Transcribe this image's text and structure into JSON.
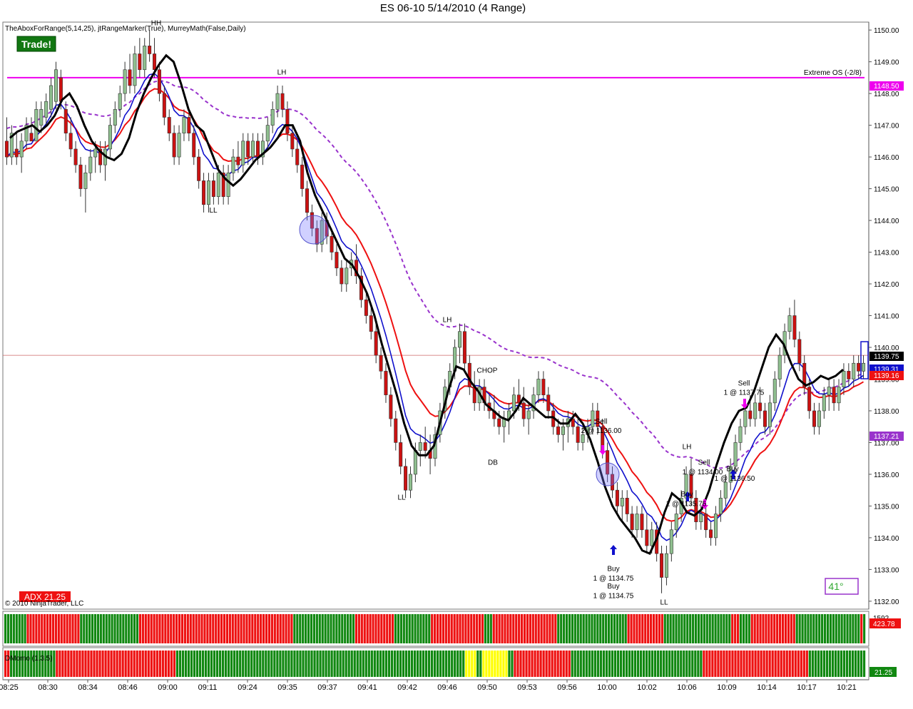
{
  "window": {
    "title": "ES 06-10  5/14/2010 (4 Range)",
    "indicator_text": "TheAboxForRange(5,14,25), jtRangeMarker(True), MurreyMath(False,Daily)",
    "trade_button": "Trade!",
    "copyright": "© 2010 NinjaTrader, LLC",
    "adx_label": "ADX 21.25",
    "angle_badge": "41°",
    "panel3_label": "DMomo (1.3.5)",
    "panel2_value": "423.78",
    "panel2_value_top": "1592",
    "panel3_value": "21.25"
  },
  "colors": {
    "up": "#8fbf8f",
    "down": "#cc1111",
    "ema_red": "#ee1111",
    "ema_blue": "#1010cc",
    "ema_orange": "#e08a00",
    "dashed": "#9933cc",
    "magenta": "#ee00ee",
    "green_bar": "#118811",
    "red_bar": "#ee1111",
    "yellow_bar": "#ffff00"
  },
  "chart_data": {
    "type": "candlestick",
    "title": "ES 06-10  5/14/2010 (4 Range)",
    "y_axis": {
      "range": [
        1131.75,
        1150.25
      ],
      "ticks": [
        "1150.00",
        "1149.00",
        "1148.00",
        "1147.00",
        "1146.00",
        "1145.00",
        "1144.00",
        "1143.00",
        "1142.00",
        "1141.00",
        "1140.00",
        "1139.00",
        "1138.00",
        "1137.00",
        "1136.00",
        "1135.00",
        "1134.00",
        "1133.00",
        "1132.00"
      ]
    },
    "x_axis": {
      "labels": [
        "08:25",
        "08:30",
        "08:34",
        "08:46",
        "09:00",
        "09:11",
        "09:24",
        "09:35",
        "09:37",
        "09:41",
        "09:42",
        "09:46",
        "09:50",
        "09:53",
        "09:56",
        "10:00",
        "10:02",
        "10:06",
        "10:09",
        "10:14",
        "10:17",
        "10:21"
      ]
    },
    "price_tags": [
      {
        "label": "1148.50",
        "price": 1148.5,
        "color": "#ee00ee"
      },
      {
        "label": "1139.75",
        "price": 1139.75,
        "color": "#000000"
      },
      {
        "label": "1139.31",
        "price": 1139.31,
        "color": "#1010cc"
      },
      {
        "label": "1139.16",
        "price": 1139.16,
        "color": "#ee1111"
      },
      {
        "label": "1137.21",
        "price": 1137.21,
        "color": "#9933cc"
      }
    ],
    "murrey_line": {
      "label": "Extreme OS (-2/8)",
      "price": 1148.5
    },
    "last_price_line": 1139.75,
    "annotations": [
      {
        "text": "HH",
        "price": 1150.15
      },
      {
        "text": "LH",
        "price": 1148.6
      },
      {
        "text": "LL",
        "price": 1144.25
      },
      {
        "text": "LL",
        "price": 1135.2
      },
      {
        "text": "LH",
        "price": 1140.8
      },
      {
        "text": "CHOP",
        "price": 1139.2
      },
      {
        "text": "DB",
        "price": 1136.3
      },
      {
        "text": "Sell",
        "price": 1137.6
      },
      {
        "text": "2 @ 1136.00",
        "price": 1137.3
      },
      {
        "text": "Buy",
        "price": 1132.95
      },
      {
        "text": "1 @ 1134.75",
        "price": 1132.65
      },
      {
        "text": "Buy",
        "price": 1132.4
      },
      {
        "text": "1 @ 1134.75",
        "price": 1132.1
      },
      {
        "text": "LL",
        "price": 1131.9
      },
      {
        "text": "LH",
        "price": 1136.8
      },
      {
        "text": "Sell",
        "price": 1136.3
      },
      {
        "text": "1 @ 1134.00",
        "price": 1136.0
      },
      {
        "text": "Buy",
        "price": 1135.3
      },
      {
        "text": "1 @ 1135.75",
        "price": 1135.0
      },
      {
        "text": "Buy",
        "price": 1136.1
      },
      {
        "text": "1 @ 1136.50",
        "price": 1135.8
      },
      {
        "text": "Sell",
        "price": 1138.8
      },
      {
        "text": "1 @ 1137.75",
        "price": 1138.5
      }
    ],
    "candles": [
      [
        1146.5,
        1147.25,
        1145.75,
        1146.0
      ],
      [
        1146.0,
        1147.0,
        1145.75,
        1146.75
      ],
      [
        1146.25,
        1146.75,
        1145.75,
        1146.0
      ],
      [
        1146.0,
        1146.75,
        1145.5,
        1146.5
      ],
      [
        1146.5,
        1147.25,
        1146.25,
        1147.0
      ],
      [
        1146.75,
        1147.25,
        1146.5,
        1146.5
      ],
      [
        1146.5,
        1147.75,
        1146.5,
        1147.5
      ],
      [
        1147.0,
        1147.75,
        1146.75,
        1147.5
      ],
      [
        1147.25,
        1148.0,
        1147.0,
        1147.75
      ],
      [
        1147.5,
        1148.5,
        1147.25,
        1148.25
      ],
      [
        1147.75,
        1149.0,
        1147.5,
        1148.75
      ],
      [
        1148.5,
        1148.75,
        1147.5,
        1147.75
      ],
      [
        1147.5,
        1147.75,
        1146.5,
        1146.75
      ],
      [
        1146.75,
        1147.25,
        1146.0,
        1146.25
      ],
      [
        1146.25,
        1146.5,
        1145.5,
        1145.75
      ],
      [
        1145.75,
        1146.0,
        1144.75,
        1145.0
      ],
      [
        1145.0,
        1145.75,
        1144.25,
        1145.5
      ],
      [
        1145.5,
        1146.25,
        1145.25,
        1146.0
      ],
      [
        1146.0,
        1146.5,
        1145.5,
        1146.25
      ],
      [
        1146.25,
        1146.5,
        1145.5,
        1145.75
      ],
      [
        1145.75,
        1146.5,
        1145.25,
        1146.25
      ],
      [
        1146.25,
        1147.25,
        1146.0,
        1147.0
      ],
      [
        1147.0,
        1147.75,
        1146.75,
        1147.5
      ],
      [
        1147.5,
        1148.25,
        1147.25,
        1148.0
      ],
      [
        1148.0,
        1149.0,
        1147.75,
        1148.75
      ],
      [
        1148.75,
        1149.25,
        1148.0,
        1148.25
      ],
      [
        1148.25,
        1149.5,
        1148.0,
        1149.25
      ],
      [
        1149.25,
        1149.75,
        1148.5,
        1148.75
      ],
      [
        1148.75,
        1149.75,
        1148.5,
        1149.5
      ],
      [
        1149.5,
        1150.0,
        1149.0,
        1149.25
      ],
      [
        1149.25,
        1149.75,
        1148.5,
        1148.75
      ],
      [
        1148.75,
        1149.0,
        1147.75,
        1148.0
      ],
      [
        1148.0,
        1148.25,
        1147.0,
        1147.25
      ],
      [
        1147.25,
        1147.5,
        1146.5,
        1146.75
      ],
      [
        1146.75,
        1147.0,
        1145.75,
        1146.0
      ],
      [
        1146.0,
        1147.0,
        1145.75,
        1146.75
      ],
      [
        1146.75,
        1147.5,
        1146.5,
        1147.25
      ],
      [
        1147.25,
        1147.5,
        1146.5,
        1146.75
      ],
      [
        1146.75,
        1147.0,
        1145.75,
        1146.0
      ],
      [
        1146.0,
        1146.25,
        1145.0,
        1145.25
      ],
      [
        1145.25,
        1145.5,
        1144.25,
        1144.5
      ],
      [
        1144.5,
        1145.5,
        1144.25,
        1145.25
      ],
      [
        1145.25,
        1145.5,
        1144.5,
        1144.75
      ],
      [
        1144.75,
        1145.75,
        1144.5,
        1145.5
      ],
      [
        1145.5,
        1145.75,
        1144.5,
        1144.75
      ],
      [
        1144.75,
        1145.75,
        1144.5,
        1145.5
      ],
      [
        1145.5,
        1146.25,
        1145.25,
        1146.0
      ],
      [
        1146.0,
        1146.5,
        1145.5,
        1145.75
      ],
      [
        1145.75,
        1146.75,
        1145.5,
        1146.5
      ],
      [
        1146.5,
        1146.75,
        1145.75,
        1146.0
      ],
      [
        1146.0,
        1146.75,
        1145.75,
        1146.5
      ],
      [
        1146.5,
        1146.75,
        1145.75,
        1146.0
      ],
      [
        1146.0,
        1146.75,
        1145.75,
        1146.5
      ],
      [
        1146.5,
        1147.25,
        1146.25,
        1147.0
      ],
      [
        1147.0,
        1147.75,
        1146.75,
        1147.5
      ],
      [
        1147.5,
        1148.25,
        1147.25,
        1148.0
      ],
      [
        1148.0,
        1148.25,
        1147.25,
        1147.5
      ],
      [
        1147.5,
        1147.75,
        1146.5,
        1146.75
      ],
      [
        1146.75,
        1147.0,
        1146.0,
        1146.25
      ],
      [
        1146.25,
        1146.5,
        1145.5,
        1145.75
      ],
      [
        1145.75,
        1146.0,
        1144.75,
        1145.0
      ],
      [
        1145.0,
        1145.25,
        1144.0,
        1144.25
      ],
      [
        1144.25,
        1144.5,
        1143.5,
        1143.75
      ],
      [
        1143.75,
        1144.0,
        1143.0,
        1143.25
      ],
      [
        1143.25,
        1144.25,
        1143.0,
        1144.0
      ],
      [
        1144.0,
        1144.25,
        1143.25,
        1143.5
      ],
      [
        1143.5,
        1143.75,
        1142.75,
        1143.0
      ],
      [
        1143.0,
        1143.25,
        1142.25,
        1142.5
      ],
      [
        1142.5,
        1142.75,
        1141.75,
        1142.0
      ],
      [
        1142.0,
        1142.75,
        1141.75,
        1142.5
      ],
      [
        1142.5,
        1143.0,
        1142.25,
        1142.75
      ],
      [
        1142.75,
        1143.25,
        1142.0,
        1142.25
      ],
      [
        1142.25,
        1142.5,
        1141.25,
        1141.5
      ],
      [
        1141.5,
        1141.75,
        1140.75,
        1141.0
      ],
      [
        1141.0,
        1141.25,
        1140.25,
        1140.5
      ],
      [
        1140.5,
        1140.75,
        1139.5,
        1139.75
      ],
      [
        1139.75,
        1140.0,
        1139.0,
        1139.25
      ],
      [
        1139.25,
        1139.5,
        1138.25,
        1138.5
      ],
      [
        1138.5,
        1138.75,
        1137.5,
        1137.75
      ],
      [
        1137.75,
        1138.0,
        1136.75,
        1137.0
      ],
      [
        1137.0,
        1137.25,
        1136.0,
        1136.25
      ],
      [
        1136.25,
        1136.5,
        1135.25,
        1135.5
      ],
      [
        1135.5,
        1136.25,
        1135.25,
        1136.0
      ],
      [
        1136.0,
        1137.0,
        1135.75,
        1136.75
      ],
      [
        1136.75,
        1137.25,
        1136.25,
        1137.0
      ],
      [
        1137.0,
        1137.5,
        1136.5,
        1136.75
      ],
      [
        1136.75,
        1137.25,
        1136.0,
        1136.5
      ],
      [
        1136.5,
        1137.5,
        1136.25,
        1137.25
      ],
      [
        1137.25,
        1138.25,
        1137.0,
        1138.0
      ],
      [
        1138.0,
        1139.0,
        1137.75,
        1138.75
      ],
      [
        1138.75,
        1139.5,
        1138.5,
        1139.25
      ],
      [
        1139.25,
        1140.25,
        1139.0,
        1140.0
      ],
      [
        1140.0,
        1140.75,
        1139.5,
        1140.5
      ],
      [
        1140.5,
        1140.75,
        1139.25,
        1139.5
      ],
      [
        1139.5,
        1139.75,
        1138.5,
        1138.75
      ],
      [
        1138.75,
        1139.25,
        1138.0,
        1138.25
      ],
      [
        1138.25,
        1139.0,
        1138.0,
        1138.75
      ],
      [
        1138.75,
        1139.0,
        1138.0,
        1138.25
      ],
      [
        1138.25,
        1138.5,
        1137.75,
        1138.0
      ],
      [
        1138.0,
        1138.5,
        1137.5,
        1137.75
      ],
      [
        1137.75,
        1138.0,
        1137.25,
        1137.5
      ],
      [
        1137.5,
        1138.0,
        1137.0,
        1137.75
      ],
      [
        1137.75,
        1138.25,
        1137.25,
        1138.0
      ],
      [
        1138.0,
        1138.75,
        1137.75,
        1138.5
      ],
      [
        1138.5,
        1139.0,
        1138.0,
        1138.25
      ],
      [
        1138.25,
        1138.75,
        1137.5,
        1137.75
      ],
      [
        1137.75,
        1138.25,
        1137.25,
        1138.0
      ],
      [
        1138.0,
        1138.75,
        1137.75,
        1138.5
      ],
      [
        1138.5,
        1139.25,
        1138.25,
        1139.0
      ],
      [
        1139.0,
        1139.25,
        1138.25,
        1138.5
      ],
      [
        1138.5,
        1138.75,
        1137.75,
        1138.0
      ],
      [
        1138.0,
        1138.25,
        1137.25,
        1137.5
      ],
      [
        1137.5,
        1137.75,
        1137.0,
        1137.25
      ],
      [
        1137.25,
        1137.75,
        1136.75,
        1137.5
      ],
      [
        1137.5,
        1138.0,
        1137.0,
        1137.75
      ],
      [
        1137.75,
        1138.0,
        1137.25,
        1137.5
      ],
      [
        1137.5,
        1137.75,
        1136.75,
        1137.0
      ],
      [
        1137.0,
        1137.5,
        1136.75,
        1137.25
      ],
      [
        1137.25,
        1137.75,
        1137.0,
        1137.5
      ],
      [
        1137.5,
        1138.25,
        1137.25,
        1138.0
      ],
      [
        1138.0,
        1138.25,
        1137.25,
        1137.5
      ],
      [
        1137.5,
        1137.75,
        1136.5,
        1136.75
      ],
      [
        1136.75,
        1137.0,
        1135.75,
        1136.0
      ],
      [
        1136.0,
        1136.25,
        1135.25,
        1135.5
      ],
      [
        1135.5,
        1135.75,
        1134.75,
        1135.0
      ],
      [
        1135.0,
        1135.5,
        1134.5,
        1135.25
      ],
      [
        1135.25,
        1135.5,
        1134.5,
        1134.75
      ],
      [
        1134.75,
        1135.0,
        1134.0,
        1134.25
      ],
      [
        1134.25,
        1135.0,
        1134.0,
        1134.75
      ],
      [
        1134.75,
        1135.0,
        1134.0,
        1134.25
      ],
      [
        1134.25,
        1134.75,
        1133.5,
        1133.75
      ],
      [
        1133.75,
        1134.5,
        1133.5,
        1134.25
      ],
      [
        1134.25,
        1134.5,
        1133.25,
        1133.5
      ],
      [
        1133.5,
        1133.75,
        1132.25,
        1132.75
      ],
      [
        1132.75,
        1133.75,
        1132.5,
        1133.5
      ],
      [
        1133.5,
        1134.5,
        1133.25,
        1134.25
      ],
      [
        1134.25,
        1135.0,
        1134.0,
        1134.75
      ],
      [
        1134.75,
        1135.5,
        1134.5,
        1135.25
      ],
      [
        1135.25,
        1136.25,
        1135.0,
        1136.0
      ],
      [
        1136.0,
        1136.5,
        1135.0,
        1135.25
      ],
      [
        1135.25,
        1135.5,
        1134.25,
        1134.5
      ],
      [
        1134.5,
        1135.0,
        1134.25,
        1134.75
      ],
      [
        1134.75,
        1135.0,
        1134.0,
        1134.25
      ],
      [
        1134.25,
        1134.5,
        1133.75,
        1134.0
      ],
      [
        1134.0,
        1135.0,
        1133.75,
        1134.75
      ],
      [
        1134.75,
        1135.5,
        1134.5,
        1135.25
      ],
      [
        1135.25,
        1136.0,
        1135.0,
        1135.75
      ],
      [
        1135.75,
        1136.5,
        1135.5,
        1136.25
      ],
      [
        1136.25,
        1137.25,
        1136.0,
        1137.0
      ],
      [
        1137.0,
        1137.75,
        1136.75,
        1137.5
      ],
      [
        1137.5,
        1138.25,
        1137.25,
        1138.0
      ],
      [
        1138.0,
        1138.5,
        1137.5,
        1137.75
      ],
      [
        1137.75,
        1138.5,
        1137.5,
        1138.25
      ],
      [
        1138.25,
        1138.75,
        1137.75,
        1138.0
      ],
      [
        1138.0,
        1138.25,
        1137.25,
        1137.5
      ],
      [
        1137.5,
        1138.5,
        1137.25,
        1138.25
      ],
      [
        1138.25,
        1139.25,
        1138.0,
        1139.0
      ],
      [
        1139.0,
        1140.0,
        1138.75,
        1139.75
      ],
      [
        1139.75,
        1140.75,
        1139.5,
        1140.5
      ],
      [
        1140.5,
        1141.25,
        1140.25,
        1141.0
      ],
      [
        1141.0,
        1141.5,
        1140.0,
        1140.25
      ],
      [
        1140.25,
        1140.5,
        1139.25,
        1139.5
      ],
      [
        1139.5,
        1139.75,
        1138.5,
        1138.75
      ],
      [
        1138.75,
        1139.0,
        1137.75,
        1138.0
      ],
      [
        1138.0,
        1138.25,
        1137.25,
        1137.5
      ],
      [
        1137.5,
        1138.25,
        1137.25,
        1138.0
      ],
      [
        1138.0,
        1138.75,
        1137.75,
        1138.5
      ],
      [
        1138.5,
        1139.0,
        1138.0,
        1138.75
      ],
      [
        1138.75,
        1139.0,
        1138.0,
        1138.25
      ],
      [
        1138.25,
        1139.0,
        1138.0,
        1138.75
      ],
      [
        1138.75,
        1139.5,
        1138.5,
        1139.25
      ],
      [
        1139.25,
        1139.5,
        1138.75,
        1139.0
      ],
      [
        1139.0,
        1139.75,
        1138.75,
        1139.5
      ],
      [
        1139.5,
        1139.75,
        1139.0,
        1139.25
      ],
      [
        1139.25,
        1139.75,
        1139.0,
        1139.5
      ]
    ],
    "swing_line": [
      1146.6,
      1146.8,
      1146.9,
      1147.0,
      1146.8,
      1147.0,
      1147.3,
      1147.8,
      1148.0,
      1147.6,
      1147.0,
      1146.5,
      1146.2,
      1146.0,
      1145.9,
      1146.1,
      1146.6,
      1147.4,
      1148.0,
      1148.5,
      1148.9,
      1149.2,
      1149.0,
      1148.3,
      1147.5,
      1147.0,
      1146.8,
      1146.2,
      1145.6,
      1145.3,
      1145.1,
      1145.3,
      1145.6,
      1145.9,
      1146.1,
      1146.3,
      1146.6,
      1147.0,
      1147.0,
      1146.5,
      1145.5,
      1144.8,
      1144.3,
      1143.8,
      1143.3,
      1142.8,
      1142.6,
      1142.2,
      1141.7,
      1141.0,
      1140.1,
      1139.3,
      1138.5,
      1137.6,
      1136.9,
      1136.6,
      1136.6,
      1136.9,
      1137.8,
      1138.7,
      1139.4,
      1139.3,
      1138.9,
      1138.6,
      1138.2,
      1138.0,
      1137.8,
      1137.7,
      1138.0,
      1138.4,
      1138.2,
      1138.0,
      1137.8,
      1137.8,
      1137.6,
      1137.6,
      1137.9,
      1137.6,
      1137.1,
      1136.4,
      1135.6,
      1135.0,
      1134.6,
      1134.3,
      1134.0,
      1133.6,
      1133.5,
      1134.0,
      1134.8,
      1135.4,
      1135.2,
      1134.8,
      1134.7,
      1134.9,
      1135.5,
      1136.3,
      1137.0,
      1137.6,
      1138.0,
      1138.1,
      1138.6,
      1139.3,
      1140.0,
      1140.4,
      1140.1,
      1139.5,
      1139.0,
      1138.8,
      1138.9,
      1139.1,
      1139.0,
      1139.1,
      1139.3
    ]
  }
}
